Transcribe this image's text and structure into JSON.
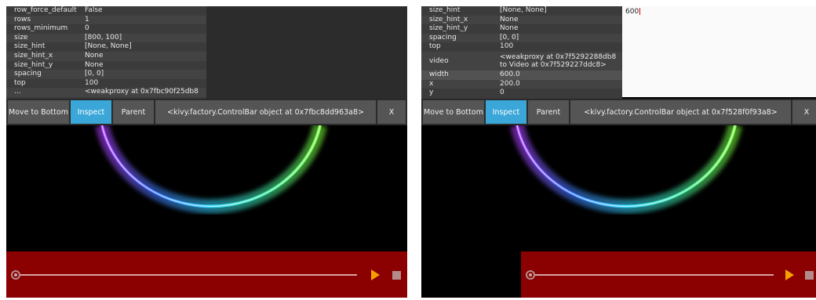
{
  "left": {
    "properties": [
      {
        "key": "row_force_default",
        "value": "False"
      },
      {
        "key": "rows",
        "value": "1"
      },
      {
        "key": "rows_minimum",
        "value": "0"
      },
      {
        "key": "size",
        "value": "[800, 100]"
      },
      {
        "key": "size_hint",
        "value": "[None, None]"
      },
      {
        "key": "size_hint_x",
        "value": "None"
      },
      {
        "key": "size_hint_y",
        "value": "None"
      },
      {
        "key": "spacing",
        "value": "[0, 0]"
      },
      {
        "key": "top",
        "value": "100"
      },
      {
        "key": "...",
        "value": "<weakproxy at 0x7fbc90f25db8"
      }
    ],
    "control_bar": {
      "move_to_bottom": "Move to Bottom",
      "inspect": "Inspect",
      "parent": "Parent",
      "widget": "<kivy.factory.ControlBar object at 0x7fbc8dd963a8>",
      "close": "X"
    }
  },
  "right": {
    "properties": [
      {
        "key": "size_hint",
        "value": "[None, None]"
      },
      {
        "key": "size_hint_x",
        "value": "None"
      },
      {
        "key": "size_hint_y",
        "value": "None"
      },
      {
        "key": "spacing",
        "value": "[0, 0]"
      },
      {
        "key": "top",
        "value": "100"
      },
      {
        "key": "video",
        "value": "<weakproxy at 0x7f5292288db8 to Video at 0x7f529227ddc8>"
      },
      {
        "key": "width",
        "value": "600.0"
      },
      {
        "key": "x",
        "value": "200.0"
      },
      {
        "key": "y",
        "value": "0"
      }
    ],
    "edit_value": "600",
    "control_bar": {
      "move_to_bottom": "Move to Bottom",
      "inspect": "Inspect",
      "parent": "Parent",
      "widget": "<kivy.factory.ControlBar object at 0x7f528f0f93a8>",
      "close": "X"
    }
  },
  "colors": {
    "accent": "#3aa7d8",
    "video_bar": "#8b0000",
    "play_icon": "#f6a000"
  },
  "icons": {
    "seek": "seek-knob-icon",
    "play": "play-icon",
    "stop": "stop-icon"
  },
  "seek_progress": 0
}
